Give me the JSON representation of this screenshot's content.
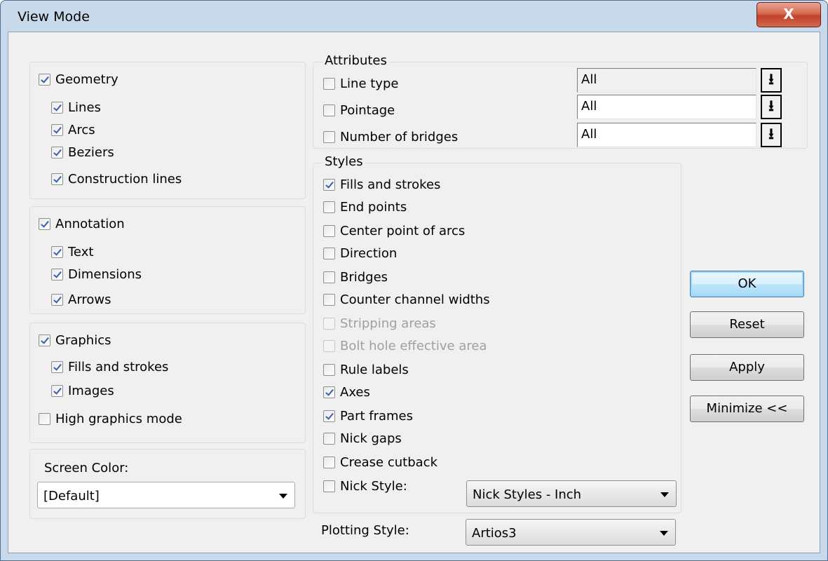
{
  "window": {
    "title": "View Mode",
    "close_glyph": "X"
  },
  "geometry": {
    "label": "Geometry",
    "checked": true,
    "items": [
      {
        "label": "Lines",
        "checked": true
      },
      {
        "label": "Arcs",
        "checked": true
      },
      {
        "label": "Beziers",
        "checked": true
      },
      {
        "label": "Construction lines",
        "checked": true
      }
    ]
  },
  "annotation": {
    "label": "Annotation",
    "checked": true,
    "items": [
      {
        "label": "Text",
        "checked": true
      },
      {
        "label": "Dimensions",
        "checked": true
      },
      {
        "label": "Arrows",
        "checked": true
      }
    ]
  },
  "graphics": {
    "label": "Graphics",
    "checked": true,
    "items": [
      {
        "label": "Fills and strokes",
        "checked": true
      },
      {
        "label": "Images",
        "checked": true
      }
    ],
    "high_mode": {
      "label": "High graphics mode",
      "checked": false
    }
  },
  "screen_color": {
    "label": "Screen Color:",
    "value": "[Default]"
  },
  "attributes": {
    "title": "Attributes",
    "rows": [
      {
        "label": "Line type",
        "checked": false,
        "value": "All"
      },
      {
        "label": "Pointage",
        "checked": false,
        "value": "All"
      },
      {
        "label": "Number of bridges",
        "checked": false,
        "value": "All"
      }
    ],
    "button_glyph": "⭳"
  },
  "styles": {
    "title": "Styles",
    "items": [
      {
        "label": "Fills and strokes",
        "checked": true,
        "disabled": false
      },
      {
        "label": "End points",
        "checked": false,
        "disabled": false
      },
      {
        "label": "Center point of arcs",
        "checked": false,
        "disabled": false
      },
      {
        "label": "Direction",
        "checked": false,
        "disabled": false
      },
      {
        "label": "Bridges",
        "checked": false,
        "disabled": false
      },
      {
        "label": "Counter channel widths",
        "checked": false,
        "disabled": false
      },
      {
        "label": "Stripping areas",
        "checked": false,
        "disabled": true
      },
      {
        "label": "Bolt hole effective area",
        "checked": false,
        "disabled": true
      },
      {
        "label": "Rule labels",
        "checked": false,
        "disabled": false
      },
      {
        "label": "Axes",
        "checked": true,
        "disabled": false
      },
      {
        "label": "Part frames",
        "checked": true,
        "disabled": false
      },
      {
        "label": "Nick gaps",
        "checked": false,
        "disabled": false
      },
      {
        "label": "Crease cutback",
        "checked": false,
        "disabled": false
      }
    ],
    "nick_style": {
      "label": "Nick Style:",
      "checked": false,
      "value": "Nick Styles - Inch"
    }
  },
  "plotting_style": {
    "label": "Plotting Style:",
    "value": "Artios3"
  },
  "buttons": {
    "ok": "OK",
    "reset": "Reset",
    "apply": "Apply",
    "minimize": "Minimize <<"
  }
}
